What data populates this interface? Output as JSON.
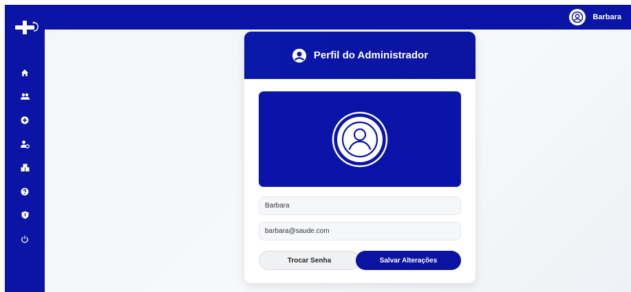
{
  "header": {
    "user_name": "Barbara"
  },
  "sidebar": {
    "logo_icon": "cross-stethoscope-logo",
    "items": [
      {
        "name": "home",
        "icon": "home-icon"
      },
      {
        "name": "users",
        "icon": "users-icon"
      },
      {
        "name": "add",
        "icon": "plus-circle-icon"
      },
      {
        "name": "doctors",
        "icon": "user-settings-icon"
      },
      {
        "name": "units",
        "icon": "buildings-icon"
      },
      {
        "name": "help",
        "icon": "question-circle-icon"
      },
      {
        "name": "security",
        "icon": "shield-icon"
      },
      {
        "name": "logout",
        "icon": "power-icon"
      }
    ]
  },
  "card": {
    "title": "Perfil do Administrador",
    "name_value": "Barbara",
    "email_value": "barbara@saude.com",
    "change_password_label": "Trocar Senha",
    "save_label": "Salvar Alterações"
  },
  "colors": {
    "primary": "#0a15a6",
    "background": "#f3f5f8",
    "card": "#ffffff"
  }
}
